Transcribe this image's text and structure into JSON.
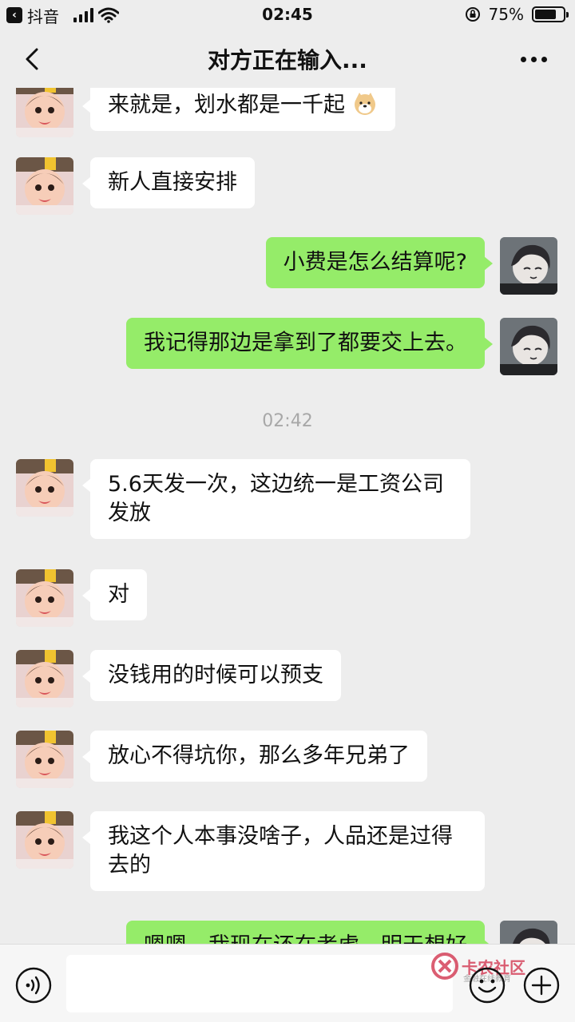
{
  "status_bar": {
    "back_app_label": "抖音",
    "time": "02:45",
    "battery_percent": "75%",
    "battery_level": 0.75
  },
  "header": {
    "back_icon": "chevron-left-icon",
    "title": "对方正在输入...",
    "more_icon": "more-dots-icon"
  },
  "messages": [
    {
      "side": "left",
      "text": "来就是，划水都是一千起"
    },
    {
      "side": "left",
      "text": "新人直接安排"
    },
    {
      "side": "right",
      "text": "小费是怎么结算呢?"
    },
    {
      "side": "right",
      "text": "我记得那边是拿到了都要交上去。"
    },
    {
      "timestamp": "02:42"
    },
    {
      "side": "left",
      "text": "5.6天发一次，这边统一是工资公司发放"
    },
    {
      "side": "left",
      "text": "对"
    },
    {
      "side": "left",
      "text": "没钱用的时候可以预支"
    },
    {
      "side": "left",
      "text": "放心不得坑你，那么多年兄弟了"
    },
    {
      "side": "left",
      "text": "我这个人本事没啥子，人品还是过得去的"
    },
    {
      "side": "right",
      "text": "嗯嗯，我现在还在考虑，明天想好"
    }
  ],
  "input_bar": {
    "voice_icon": "voice-icon",
    "emoji_icon": "emoji-icon",
    "plus_icon": "plus-icon",
    "watermark": "卡农社区",
    "watermark_sub": "金融在线教育"
  },
  "colors": {
    "background": "#ededed",
    "sent_bubble": "#95ec69",
    "received_bubble": "#ffffff"
  }
}
